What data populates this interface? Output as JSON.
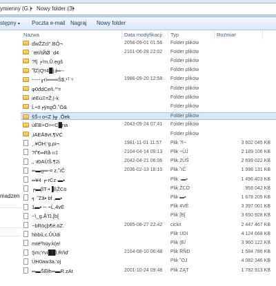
{
  "address": {
    "crumbs": [
      "ymienny (G:)",
      "Nowy folder (3)"
    ]
  },
  "toolbar": {
    "organize": "stępny",
    "email": "Poczta e-mail",
    "burn": "Nagraj",
    "new_folder": "Nowy folder"
  },
  "nav": {
    "label": "madzen"
  },
  "columns": {
    "name": "Nazwa",
    "date": "Data modyfikacji",
    "type": "Typ",
    "size": "Rozmiar"
  },
  "rows": [
    {
      "kind": "folder",
      "name": "ďwŽZcl°.ВÔ¬",
      "date": "2058-09-01 01:56",
      "type": "Folder plików",
      "size": ""
    },
    {
      "kind": "folder",
      "name": "¨ёКñЙǾ ˈd4",
      "date": "2101-06-28 22:02",
      "type": "Folder plików",
      "size": ""
    },
    {
      "kind": "folder",
      "name": "?f| ╒'m,Ũ.egš",
      "date": "",
      "type": "Folder plików",
      "size": ""
    },
    {
      "kind": "folder",
      "name": "˚f̈Z)Qт4█|Ⅎ═--",
      "date": "",
      "type": "Folder plików",
      "size": ""
    },
    {
      "kind": "folder",
      "name": "-----╓ri═══Ŝ$,¹ᵀʿᵘ",
      "date": "1986-09-20 12:58",
      "type": "Folder plików",
      "size": ""
    },
    {
      "kind": "folder",
      "name": "φ0đdCeñ.^'=",
      "date": "",
      "type": "Folder plików",
      "size": ""
    },
    {
      "kind": "folder",
      "name": "iéEúΞ=Ž,|-k",
      "date": "",
      "type": "Folder plików",
      "size": ""
    },
    {
      "kind": "folder",
      "name": "Ĺ÷ö╒ÿngÔ.˚Ó&",
      "date": "",
      "type": "Folder plików",
      "size": ""
    },
    {
      "kind": "folder",
      "name": "šŠ-ι  ο<Z |╦ .Ôek",
      "date": "",
      "type": "Folder plików",
      "size": "",
      "selected": true
    },
    {
      "kind": "folder",
      "name": "ùEB>O><C█na",
      "date": "2043-09-24 07:41",
      "type": "Folder plików",
      "size": ""
    },
    {
      "kind": "folder",
      "name": "‚iAEĀ8vt.¶VĆ",
      "date": "",
      "type": "Folder plików",
      "size": ""
    },
    {
      "kind": "file",
      "name": "¸.¥ÖH:'g,pi¬",
      "date": "1981-11-01 11:57",
      "type": "Plik ?l¬",
      "size": "3 602 045 KB"
    },
    {
      "kind": "file",
      "name": "?Ѓ€═Rå·ıı‡",
      "date": "2104-04-14 09:13",
      "type": "Plik ÷ÛĴ",
      "size": "2 189 106 KB"
    },
    {
      "kind": "file",
      "name": "‚, ıÐAÙŠ.¶2i",
      "date": "2042-04-21 06:06",
      "type": "Plik 2ÙŠ",
      "size": "2 699 022 KB"
    },
    {
      "kind": "file",
      "name": "═▬╦═-¤ z,˚ïĈ",
      "date": "2036-02-13 18:10",
      "type": "Plik ˚ïĈ",
      "size": "1 998 131 KB"
    },
    {
      "kind": "file",
      "name": "═¥4 ╒-rĆz·▬▪",
      "date": "",
      "type": "Plik ·▬▪",
      "size": "1 496 403 KB"
    },
    {
      "kind": "file",
      "name": "╒▬βT-▪▐ßŽCö",
      "date": "",
      "type": "Plik ŽCÖ",
      "size": "956 042 KB"
    },
    {
      "kind": "file",
      "name": "╕ ˜Zã▪ bf ,▬▪",
      "date": "",
      "type": "Plik ▬▪",
      "size": "1 678 205 KB"
    },
    {
      "kind": "file",
      "name": "1▬▪ ─ ÷Ĺ,4vÉ",
      "date": "",
      "type": "Plik 4VÉ",
      "size": "3 397 001 KB"
    },
    {
      "kind": "file",
      "name": "~\\_g.Å'Ŋ,[b[",
      "date": "",
      "type": "Plik [B[",
      "size": "3 650 928 KB"
    },
    {
      "kind": "file",
      "name": "~bRöçþ¶é.öZ.",
      "date": "2085-08-27 22:42",
      "type": "cickit",
      "size": "2 447 467 KB"
    },
    {
      "kind": "file",
      "name": "hbbû,c.ŮÙdi",
      "date": "",
      "type": "Plik ÙDI",
      "size": "4 124 668 KB"
    },
    {
      "kind": "file",
      "name": "mtéºhüy.ḱ(e/",
      "date": "",
      "type": "Plik (E/",
      "size": "3 960 122 KB"
    },
    {
      "kind": "file",
      "name": "Şm;Yvı██ĭ.Ŕñd'",
      "date": "2104-08-10 06:48",
      "type": "Plik ŔÑD",
      "size": "1 584 786 KB"
    },
    {
      "kind": "file",
      "name": "ÜH0aw3a.'oj",
      "date": "",
      "type": "Plik ˚OJ",
      "size": "4 082 346 KB"
    },
    {
      "kind": "file",
      "name": "═▬ŠЁłh═▬R.zAt",
      "date": "2001-10-24 09:48",
      "type": "Plik ZĄT",
      "size": "1 782 913 KB"
    }
  ]
}
